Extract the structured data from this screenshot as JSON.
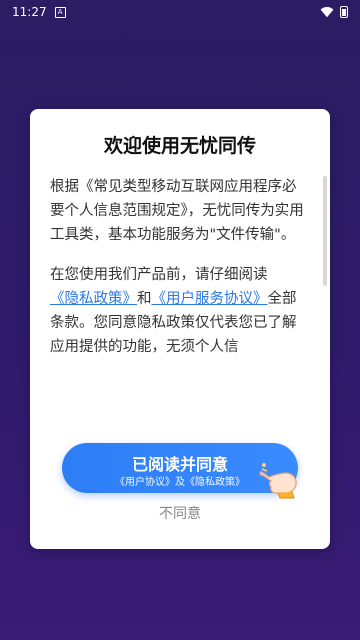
{
  "status_bar": {
    "time": "11:27",
    "notification_icon_letter": "A",
    "icons": [
      "notification-icon",
      "wifi-icon",
      "battery-icon"
    ]
  },
  "dialog": {
    "title": "欢迎使用无忧同传",
    "paragraph1": "根据《常见类型移动互联网应用程序必要个人信息范围规定》，无忧同传为实用工具类，基本功能服务为\"文件传输\"。",
    "paragraph2": {
      "before": "在您使用我们产品前，请仔细阅读",
      "link_privacy": "《隐私政策》",
      "and": "和",
      "link_terms": "《用户服务协议》",
      "after": "全部条款。您同意隐私政策仅代表您已了解应用提供的功能，无须个人信"
    },
    "agree_button": {
      "label": "已阅读并同意",
      "sublabel": "《用户协议》及《隐私政策》"
    },
    "disagree_label": "不同意"
  },
  "colors": {
    "background_top": "#2a1d63",
    "background_bottom": "#3a1b76",
    "accent_blue": "#2d7df6",
    "link_blue": "#2a79e6"
  }
}
